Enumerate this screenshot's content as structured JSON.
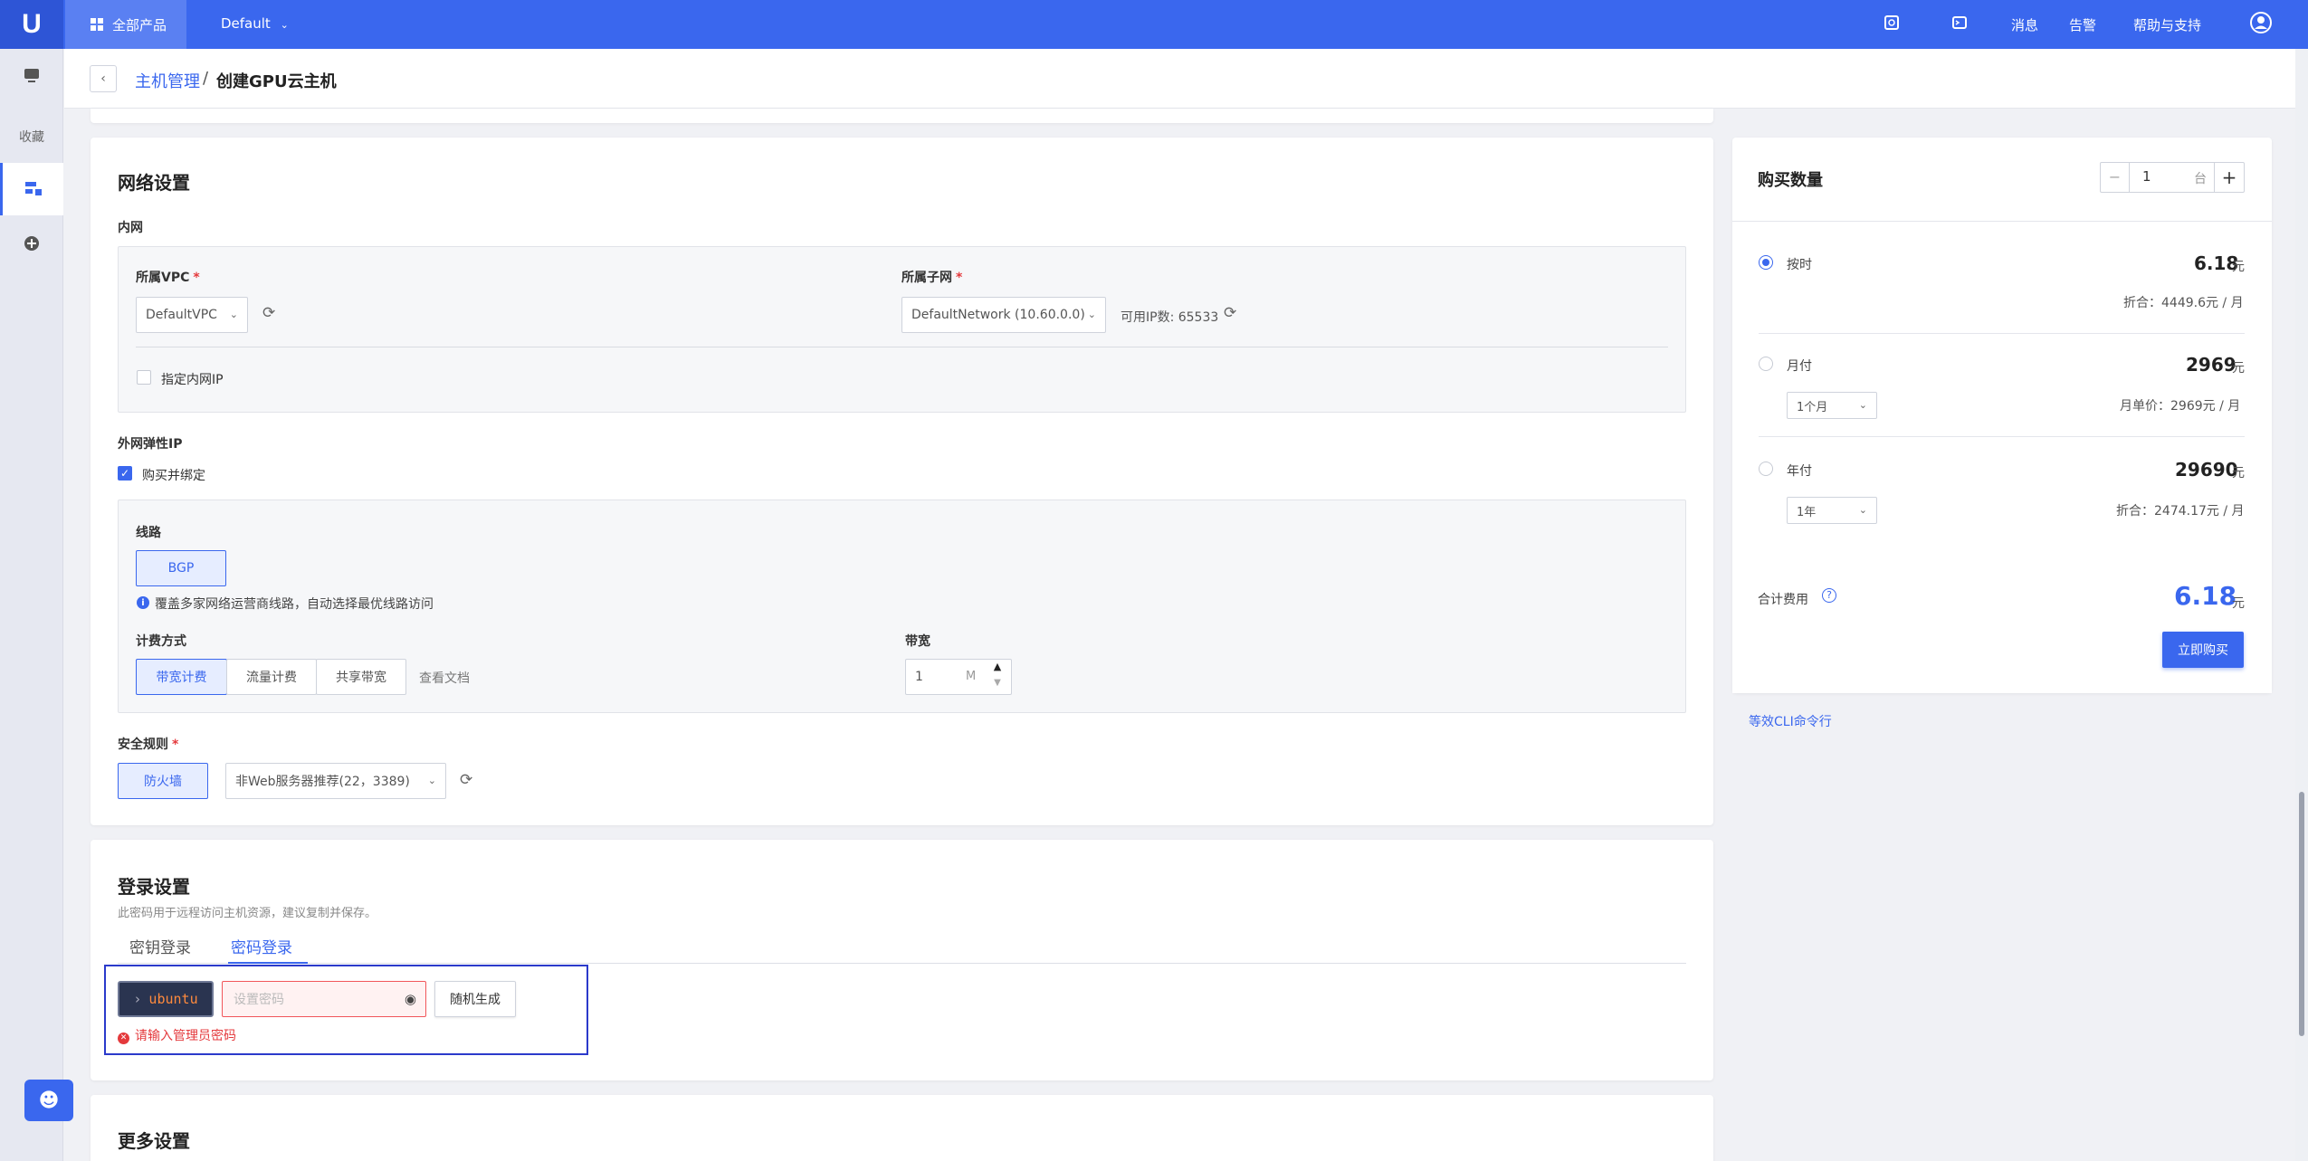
{
  "topbar": {
    "logo": "U",
    "all_products": "全部产品",
    "project": "Default",
    "messages": "消息",
    "alerts": "告警",
    "help": "帮助与支持"
  },
  "sidebar": {
    "favorites": "收藏"
  },
  "breadcrumb": {
    "parent": "主机管理",
    "separator": "/",
    "current": "创建GPU云主机"
  },
  "network": {
    "title": "网络设置",
    "intranet_label": "内网",
    "vpc_label": "所属VPC",
    "vpc_value": "DefaultVPC",
    "subnet_label": "所属子网",
    "subnet_value": "DefaultNetwork (10.60.0.0)",
    "available_ip": "可用IP数: 65533",
    "specify_ip": "指定内网IP",
    "eip_label": "外网弹性IP",
    "buy_bind": "购买并绑定",
    "line_label": "线路",
    "line_value": "BGP",
    "line_hint": "覆盖多家网络运营商线路，自动选择最优线路访问",
    "billing_label": "计费方式",
    "billing_options": [
      "带宽计费",
      "流量计费",
      "共享带宽"
    ],
    "view_docs": "查看文档",
    "bandwidth_label": "带宽",
    "bandwidth_value": "1",
    "bandwidth_unit": "M",
    "security_label": "安全规则",
    "firewall": "防火墙",
    "security_value": "非Web服务器推荐(22，3389)"
  },
  "login": {
    "title": "登录设置",
    "hint": "此密码用于远程访问主机资源，建议复制并保存。",
    "tabs": [
      "密钥登录",
      "密码登录"
    ],
    "user": "ubuntu",
    "password_placeholder": "设置密码",
    "random_btn": "随机生成",
    "error": "请输入管理员密码"
  },
  "more": {
    "title": "更多设置"
  },
  "purchase": {
    "title": "购买数量",
    "qty": "1",
    "qty_unit": "台",
    "plans": [
      {
        "label": "按时",
        "price": "6.18",
        "unit": "元",
        "sub": "折合：4449.6元 / 月"
      },
      {
        "label": "月付",
        "price": "2969",
        "unit": "元",
        "period": "1个月",
        "sub": "月单价：2969元 / 月"
      },
      {
        "label": "年付",
        "price": "29690",
        "unit": "元",
        "period": "1年",
        "sub": "折合：2474.17元 / 月"
      }
    ],
    "total_label": "合计费用",
    "total": "6.18",
    "total_unit": "元",
    "buy_btn": "立即购买",
    "cli": "等效CLI命令行"
  },
  "colors": {
    "primary": "#3a67ee",
    "error": "#e4393c"
  }
}
